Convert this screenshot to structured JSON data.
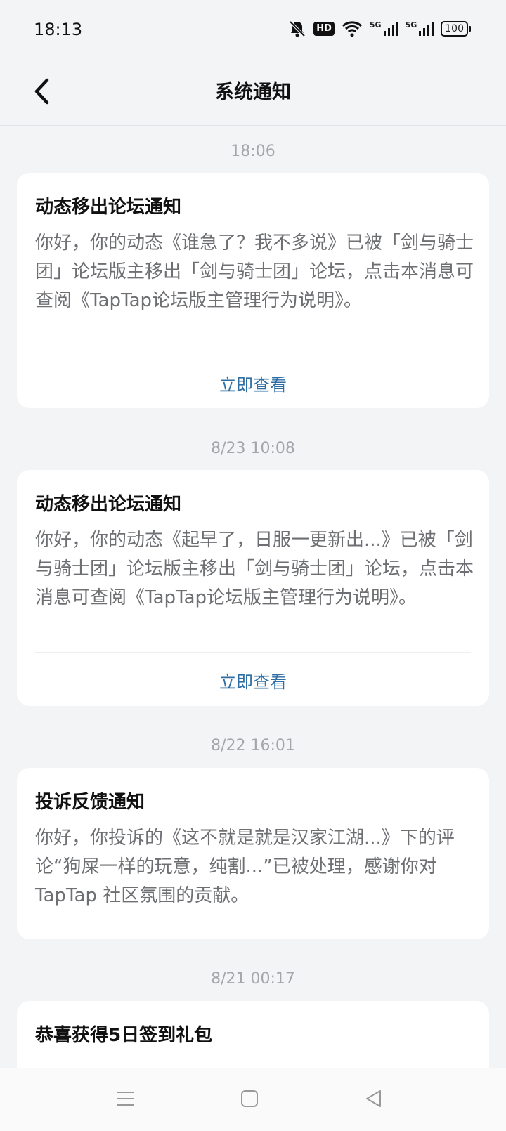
{
  "status_bar": {
    "time": "18:13",
    "icons": [
      "bell-muted-icon",
      "hd-icon",
      "wifi-icon",
      "5g-signal-icon",
      "5g-signal-icon",
      "battery-icon"
    ],
    "hd_label": "HD",
    "network_label": "5G",
    "battery_level": "100"
  },
  "header": {
    "title": "系统通知",
    "back_icon": "back-arrow-icon"
  },
  "notifications": [
    {
      "timestamp": "18:06",
      "title": "动态移出论坛通知",
      "body": "你好，你的动态《谁急了？我不多说》已被「剑与骑士团」论坛版主移出「剑与骑士团」论坛，点击本消息可查阅《TapTap论坛版主管理行为说明》。",
      "action": "立即查看"
    },
    {
      "timestamp": "8/23  10:08",
      "title": "动态移出论坛通知",
      "body": "你好，你的动态《起早了，日服一更新出...》已被「剑与骑士团」论坛版主移出「剑与骑士团」论坛，点击本消息可查阅《TapTap论坛版主管理行为说明》。",
      "action": "立即查看"
    },
    {
      "timestamp": "8/22  16:01",
      "title": "投诉反馈通知",
      "body": "你好，你投诉的《这不就是就是汉家江湖...》下的评论“狗屎一样的玩意，纯割...”已被处理，感谢你对 TapTap 社区氛围的贡献。"
    },
    {
      "timestamp": "8/21  00:17",
      "title": "恭喜获得5日签到礼包"
    }
  ],
  "nav_bar": {
    "icons": [
      "menu-icon",
      "home-square-icon",
      "back-triangle-icon"
    ]
  },
  "colors": {
    "background": "#f3f4f6",
    "card": "#ffffff",
    "action_link": "#2f6ea3",
    "timestamp": "#a3a6ab",
    "body_text": "#6d6f73"
  }
}
